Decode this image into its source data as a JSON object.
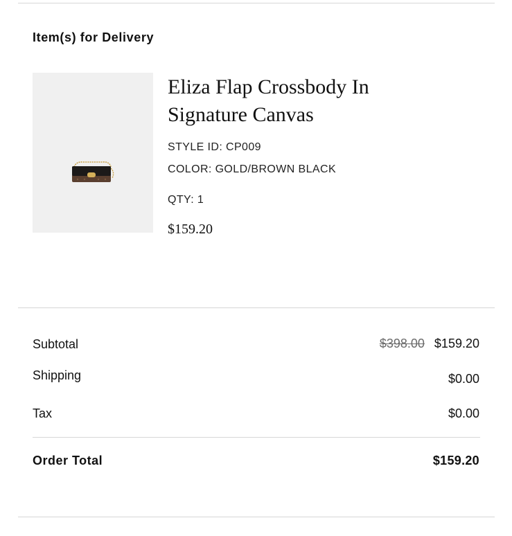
{
  "delivery": {
    "heading": "Item(s) for Delivery"
  },
  "item": {
    "name": "Eliza Flap Crossbody In Signature Canvas",
    "style_id": "STYLE ID: CP009",
    "color": "COLOR: GOLD/BROWN BLACK",
    "qty": "QTY: 1",
    "price": "$159.20",
    "image_icon": "crossbody-bag-image"
  },
  "summary": {
    "subtotal_label": "Subtotal",
    "subtotal_original": "$398.00",
    "subtotal_value": "$159.20",
    "shipping_label": "Shipping",
    "shipping_value": "$0.00",
    "tax_label": "Tax",
    "tax_value": "$0.00",
    "order_total_label": "Order Total",
    "order_total_value": "$159.20"
  },
  "colors": {
    "divider": "#d6d6d6",
    "image_background": "#f0f0f0",
    "strikethrough_text": "#6a6a6a"
  }
}
